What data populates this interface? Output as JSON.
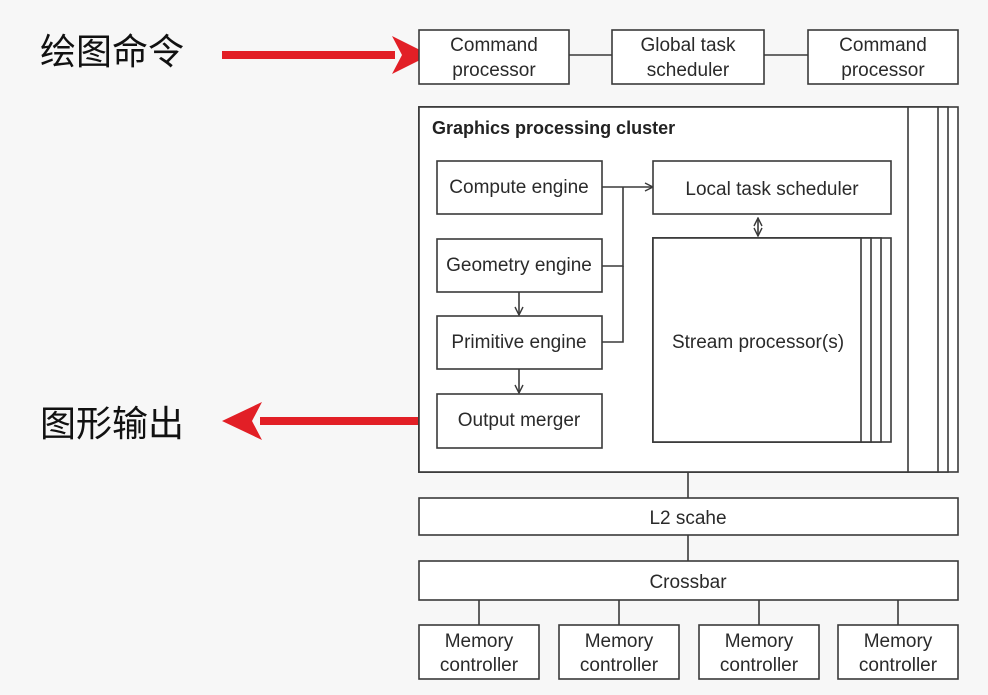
{
  "labels": {
    "draw_commands": "绘图命令",
    "graphics_output": "图形输出"
  },
  "top": {
    "command_processor_left": [
      "Command",
      "processor"
    ],
    "global_task_scheduler": [
      "Global task",
      "scheduler"
    ],
    "command_processor_right": [
      "Command",
      "processor"
    ]
  },
  "gpc": {
    "title": "Graphics processing cluster",
    "compute_engine": "Compute engine",
    "geometry_engine": "Geometry engine",
    "primitive_engine": "Primitive engine",
    "output_merger": "Output merger",
    "local_task_scheduler": "Local task scheduler",
    "stream_processors": "Stream processor(s)"
  },
  "l2_cache": "L2 scahe",
  "crossbar": "Crossbar",
  "memory_controllers": [
    [
      "Memory",
      "controller"
    ],
    [
      "Memory",
      "controller"
    ],
    [
      "Memory",
      "controller"
    ],
    [
      "Memory",
      "controller"
    ]
  ],
  "colors": {
    "accent_arrow": "#e21f26",
    "stroke": "#3a3a3a"
  }
}
